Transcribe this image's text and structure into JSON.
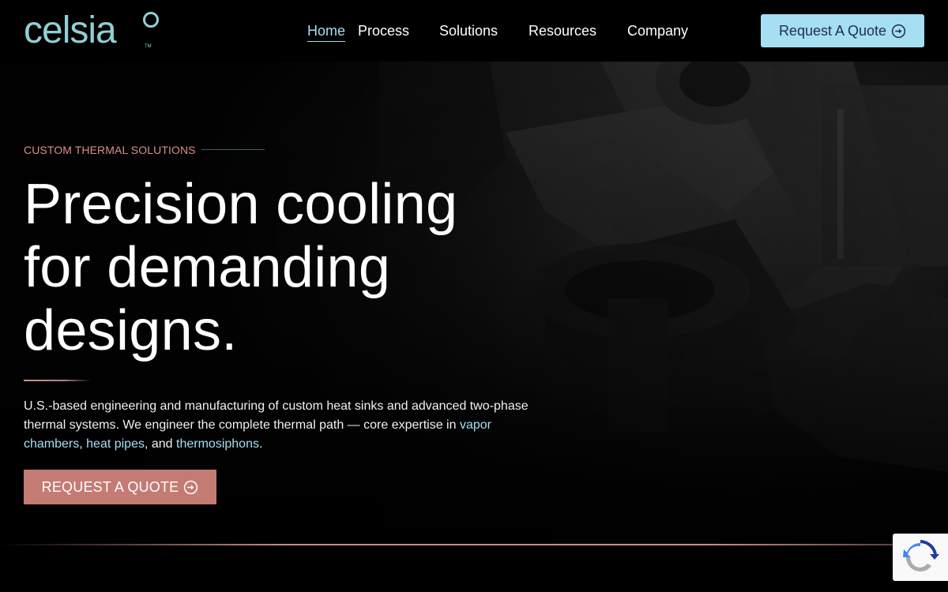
{
  "brand": {
    "logo_text": "celsia",
    "trademark": "TM",
    "color": "#8fd0d6"
  },
  "nav": {
    "items": [
      {
        "label": "Home",
        "active": true
      },
      {
        "label": "Process",
        "active": false
      },
      {
        "label": "Solutions",
        "active": false
      },
      {
        "label": "Resources",
        "active": false
      },
      {
        "label": "Company",
        "active": false
      }
    ],
    "cta_label": "Request A Quote",
    "cta_icon": "circle-arrow-icon"
  },
  "hero": {
    "eyebrow": "CUSTOM THERMAL SOLUTIONS",
    "headline_lines": [
      "Precision cooling",
      "for demanding",
      "designs."
    ],
    "body": {
      "intro": "U.S.-based engineering and manufacturing of custom heat sinks and advanced two-phase thermal systems. We engineer the complete thermal path — core expertise in ",
      "link_vapor": "vapor chambers",
      "sep1": ", ",
      "link_heat": "heat pipes",
      "sep2": ", and ",
      "link_thermo": "thermosiphons",
      "end": "."
    },
    "cta_label": "REQUEST A QUOTE",
    "cta_icon": "circle-arrow-icon"
  },
  "colors": {
    "accent_blue": "#a6def2",
    "accent_rose": "#c47b74",
    "eyebrow": "#d9908a",
    "button_text_dark": "#1e2d55"
  },
  "recaptcha": {
    "icon": "recaptcha-icon"
  }
}
